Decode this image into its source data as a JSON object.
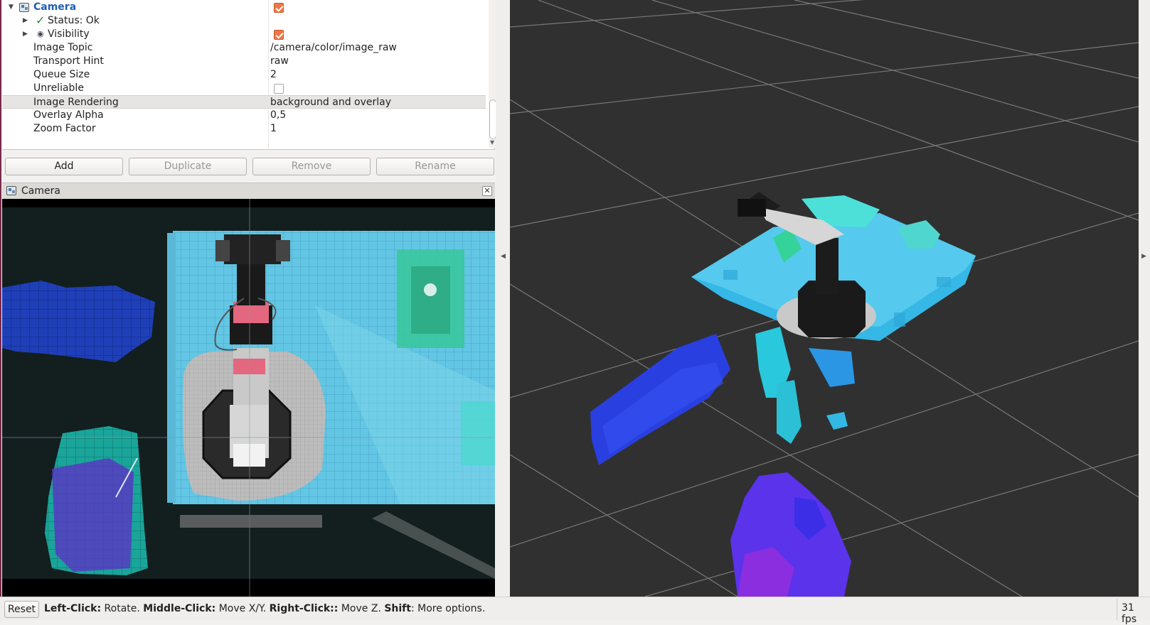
{
  "displays": {
    "camera_label": "Camera",
    "status_label": "Status: Ok",
    "visibility_label": "Visibility",
    "properties": [
      {
        "name": "Image Topic",
        "value": "/camera/color/image_raw"
      },
      {
        "name": "Transport Hint",
        "value": "raw"
      },
      {
        "name": "Queue Size",
        "value": "2"
      },
      {
        "name": "Unreliable",
        "value": ""
      },
      {
        "name": "Image Rendering",
        "value": "background and overlay"
      },
      {
        "name": "Overlay Alpha",
        "value": "0,5"
      },
      {
        "name": "Zoom Factor",
        "value": "1"
      }
    ],
    "camera_enabled": true,
    "visibility_enabled": true,
    "unreliable_checked": false
  },
  "buttons": {
    "add": "Add",
    "duplicate": "Duplicate",
    "remove": "Remove",
    "rename": "Rename"
  },
  "camera_panel": {
    "title": "Camera",
    "close_icon": "close-icon"
  },
  "status_bar": {
    "reset": "Reset",
    "left_click_key": "Left-Click:",
    "left_click_text": " Rotate. ",
    "middle_click_key": "Middle-Click:",
    "middle_click_text": " Move X/Y. ",
    "right_click_key": "Right-Click::",
    "right_click_text": " Move Z. ",
    "shift_key": "Shift",
    "shift_text": ": More options.",
    "fps": "31 fps"
  },
  "colors": {
    "accent_checkbox": "#f07746",
    "camera_label": "#1f5fb5",
    "grid_background": "#303030",
    "voxel_cyan": "#3ec8e8",
    "voxel_blue": "#2a3fd6",
    "voxel_purple": "#6a2ae0"
  }
}
